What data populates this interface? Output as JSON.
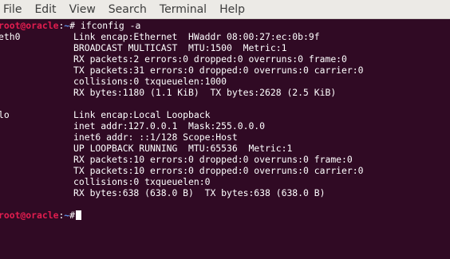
{
  "menu": {
    "items": [
      "File",
      "Edit",
      "View",
      "Search",
      "Terminal",
      "Help"
    ]
  },
  "colors": {
    "background": "#300a24",
    "foreground": "#ffffff",
    "prompt_user": "#e21d4f",
    "prompt_path": "#5b8ee6"
  },
  "prompt": {
    "user_host": "root@oracle",
    "sep": ":",
    "path": "~",
    "symbol": "#"
  },
  "command": " ifconfig -a",
  "interfaces": [
    {
      "name": "eth0",
      "lines": [
        "Link encap:Ethernet  HWaddr 08:00:27:ec:0b:9f",
        "BROADCAST MULTICAST  MTU:1500  Metric:1",
        "RX packets:2 errors:0 dropped:0 overruns:0 frame:0",
        "TX packets:31 errors:0 dropped:0 overruns:0 carrier:0",
        "collisions:0 txqueuelen:1000",
        "RX bytes:1180 (1.1 KiB)  TX bytes:2628 (2.5 KiB)"
      ]
    },
    {
      "name": "lo",
      "lines": [
        "Link encap:Local Loopback",
        "inet addr:127.0.0.1  Mask:255.0.0.0",
        "inet6 addr: ::1/128 Scope:Host",
        "UP LOOPBACK RUNNING  MTU:65536  Metric:1",
        "RX packets:10 errors:0 dropped:0 overruns:0 frame:0",
        "TX packets:10 errors:0 dropped:0 overruns:0 carrier:0",
        "collisions:0 txqueuelen:0",
        "RX bytes:638 (638.0 B)  TX bytes:638 (638.0 B)"
      ]
    }
  ]
}
